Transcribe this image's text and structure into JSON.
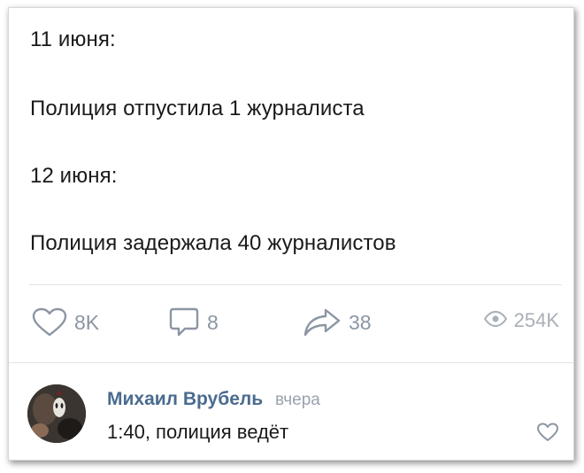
{
  "post": {
    "lines": [
      "11 июня:",
      "Полиция отпустила 1 журналиста",
      "12 июня:",
      "Полиция задержала 40 журналистов"
    ]
  },
  "actions": {
    "likes": {
      "icon": "heart-icon",
      "count": "8K"
    },
    "comments": {
      "icon": "comment-icon",
      "count": "8"
    },
    "shares": {
      "icon": "share-icon",
      "count": "38"
    },
    "views": {
      "icon": "eye-icon",
      "count": "254K"
    }
  },
  "comment": {
    "author": "Михаил Врубель",
    "time": "вчера",
    "text": "1:40, полиция ведёт",
    "like_icon": "heart-icon"
  },
  "colors": {
    "text": "#1a1a1a",
    "author_name": "#4a6b8f",
    "muted": "#8c96a3",
    "divider": "#e3e3e3"
  }
}
